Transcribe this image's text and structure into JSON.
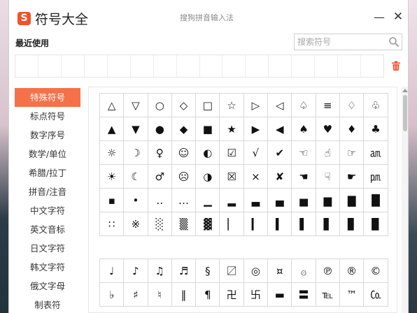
{
  "window": {
    "logo_char": "S",
    "title": "符号大全",
    "ime_name": "搜狗拼音输入法",
    "minimize_glyph": "—",
    "close_glyph": "✕"
  },
  "recent": {
    "label": "最近使用",
    "cell_count": 16
  },
  "search": {
    "placeholder": "搜索符号",
    "value": ""
  },
  "categories": [
    "特殊符号",
    "标点符号",
    "数字序号",
    "数学/单位",
    "希腊/拉丁",
    "拼音/注音",
    "中文字符",
    "英文音标",
    "日文字符",
    "韩文字符",
    "俄文字母",
    "制表符"
  ],
  "active_category": "特殊符号",
  "symbols_group1": [
    [
      "△",
      "▽",
      "○",
      "◇",
      "□",
      "☆",
      "▷",
      "◁",
      "♤",
      "≡",
      "♢",
      "♧"
    ],
    [
      "▲",
      "▼",
      "●",
      "◆",
      "■",
      "★",
      "▶",
      "◀",
      "♠",
      "♥",
      "♦",
      "♣"
    ],
    [
      "☼",
      "☽",
      "♀",
      "☺",
      "◐",
      "☑",
      "√",
      "✔",
      "☜",
      "☝",
      "☞",
      "㏂"
    ],
    [
      "☀",
      "☾",
      "♂",
      "☹",
      "◑",
      "☒",
      "×",
      "✘",
      "☚",
      "☟",
      "☛",
      "㏘"
    ],
    [
      "▪",
      "•",
      "‥",
      "…",
      "▁",
      "▂",
      "▃",
      "▄",
      "▅",
      "▆",
      "▇",
      "█"
    ],
    [
      "∷",
      "※",
      "░",
      "▒",
      "▓",
      "▏",
      "▎",
      "▍",
      "▌",
      "▋",
      "▊",
      "▉"
    ]
  ],
  "symbols_group2": [
    [
      "♩",
      "♪",
      "♫",
      "♬",
      "§",
      "〼",
      "◎",
      "¤",
      "۞",
      "℗",
      "®",
      "©"
    ],
    [
      "♭",
      "♯",
      "♮",
      "‖",
      "¶",
      "卍",
      "卐",
      "▬",
      "〓",
      "℡",
      "™",
      "㏇"
    ]
  ],
  "colors": {
    "accent": "#f4714a",
    "logo": "#f0522a",
    "trash": "#f0522a"
  }
}
